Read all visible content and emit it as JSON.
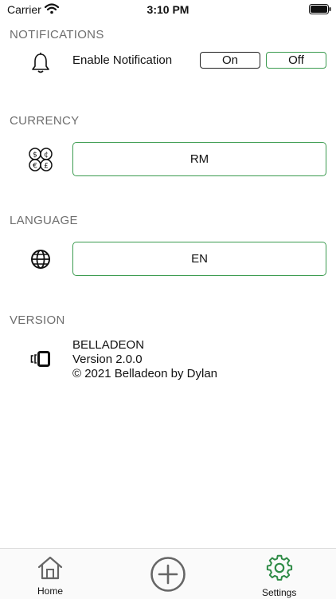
{
  "status_bar": {
    "carrier": "Carrier",
    "time": "3:10 PM"
  },
  "notifications": {
    "section_title": "NOTIFICATIONS",
    "icon": "bell-icon",
    "label": "Enable Notification",
    "on_label": "On",
    "off_label": "Off",
    "selected": "Off"
  },
  "currency": {
    "section_title": "CURRENCY",
    "icon": "currency-exchange-icon",
    "value": "RM"
  },
  "language": {
    "section_title": "LANGUAGE",
    "icon": "globe-icon",
    "value": "EN"
  },
  "version": {
    "section_title": "VERSION",
    "icon": "device-icon",
    "app_name": "BELLADEON",
    "version_text": "Version 2.0.0",
    "copyright": "© 2021 Belladeon by Dylan"
  },
  "tabbar": {
    "home_label": "Home",
    "add_icon": "add-circle-icon",
    "settings_label": "Settings",
    "active_tab": "Settings",
    "accent_color": "#2e8b46"
  },
  "colors": {
    "accent_green": "#3b9b4f",
    "section_gray": "#6e6e6e"
  }
}
